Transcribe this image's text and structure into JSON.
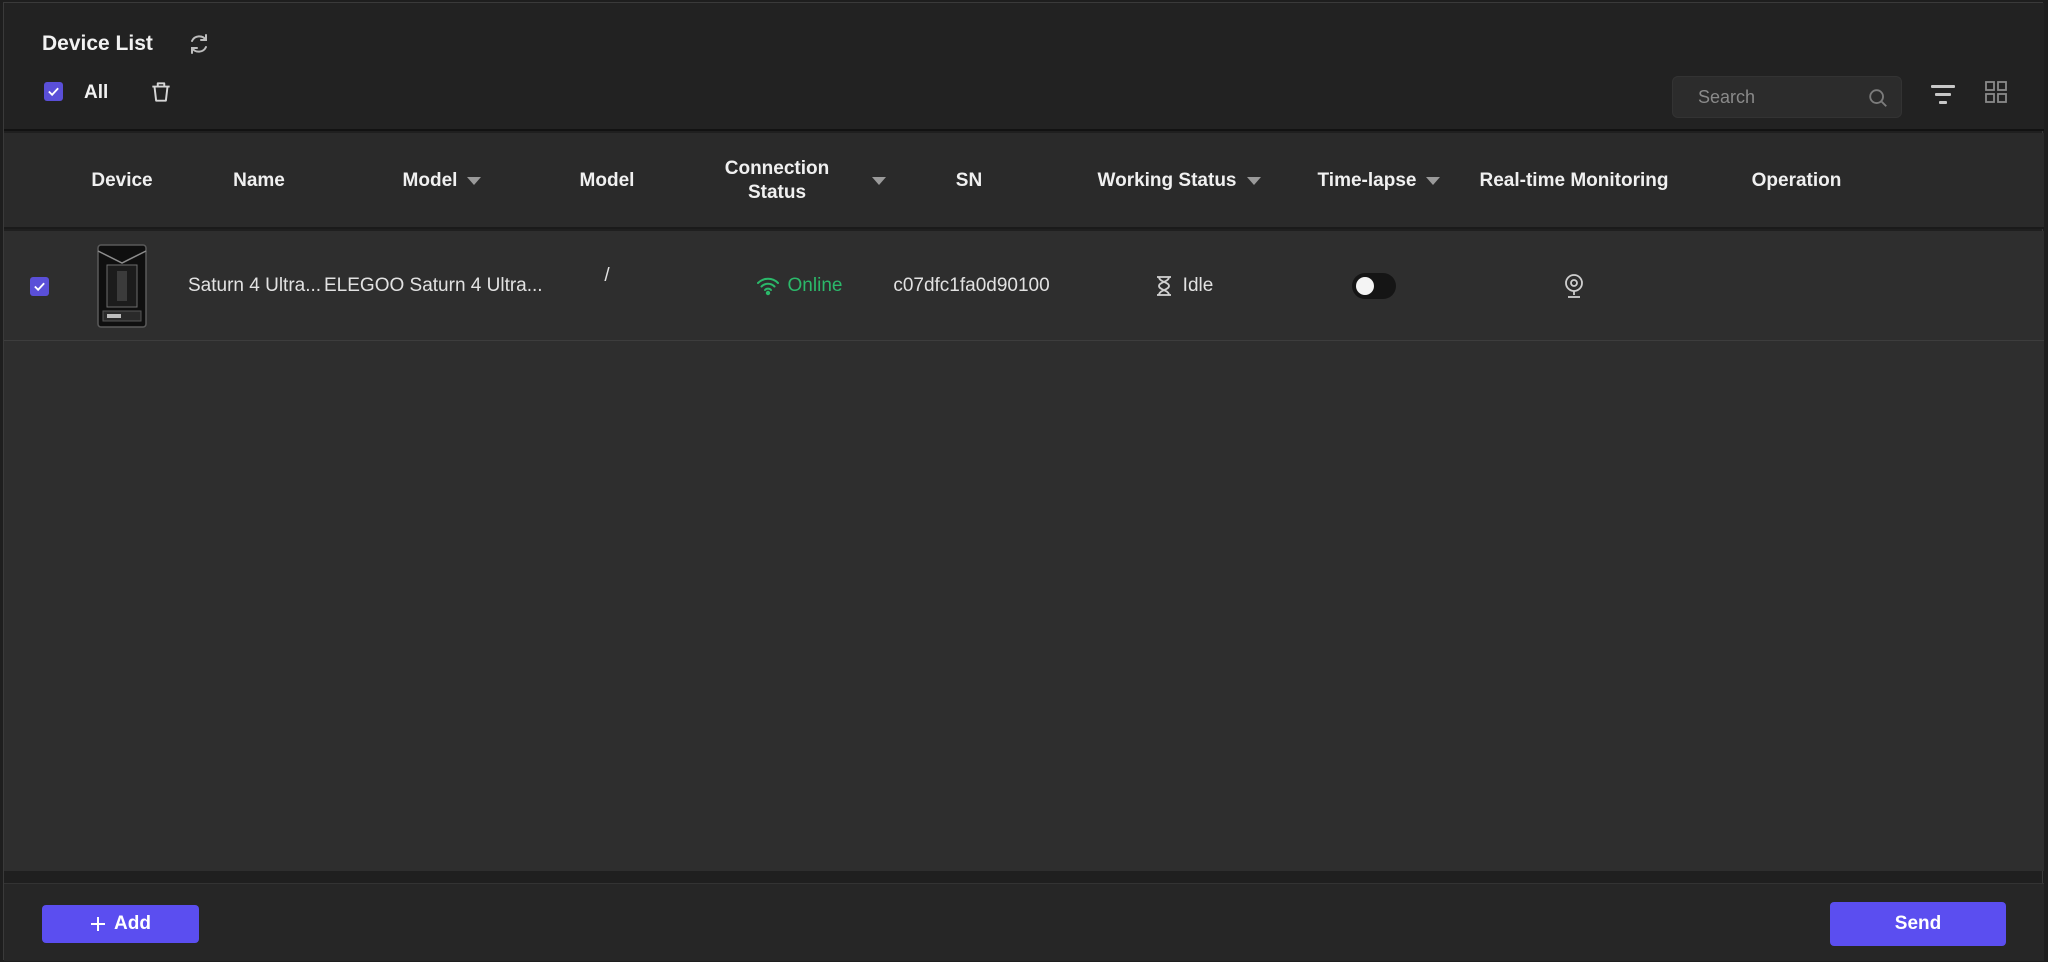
{
  "header": {
    "title": "Device List",
    "all_label": "All",
    "search_placeholder": "Search",
    "icons": [
      "refresh-icon",
      "trash-icon",
      "search-icon",
      "filter-icon",
      "grid-view-icon"
    ]
  },
  "table": {
    "columns": {
      "device": "Device",
      "name": "Name",
      "model_filter": "Model",
      "model": "Model",
      "connection_status": "Connection Status",
      "sn": "SN",
      "working_status": "Working Status",
      "timelapse": "Time-lapse",
      "monitoring": "Real-time Monitoring",
      "operation": "Operation"
    },
    "rows": [
      {
        "checked": true,
        "name": "Saturn 4 Ultra...",
        "model_filter": "ELEGOO Saturn 4 Ultra...",
        "model": "/",
        "connection_status": "Online",
        "sn": "c07dfc1fa0d90100",
        "working_status": "Idle",
        "timelapse_on": false
      }
    ]
  },
  "footer": {
    "add_label": "Add",
    "send_label": "Send"
  },
  "colors": {
    "accent": "#5b4ef0",
    "online": "#2bb96a",
    "background": "#1f1f1f"
  }
}
